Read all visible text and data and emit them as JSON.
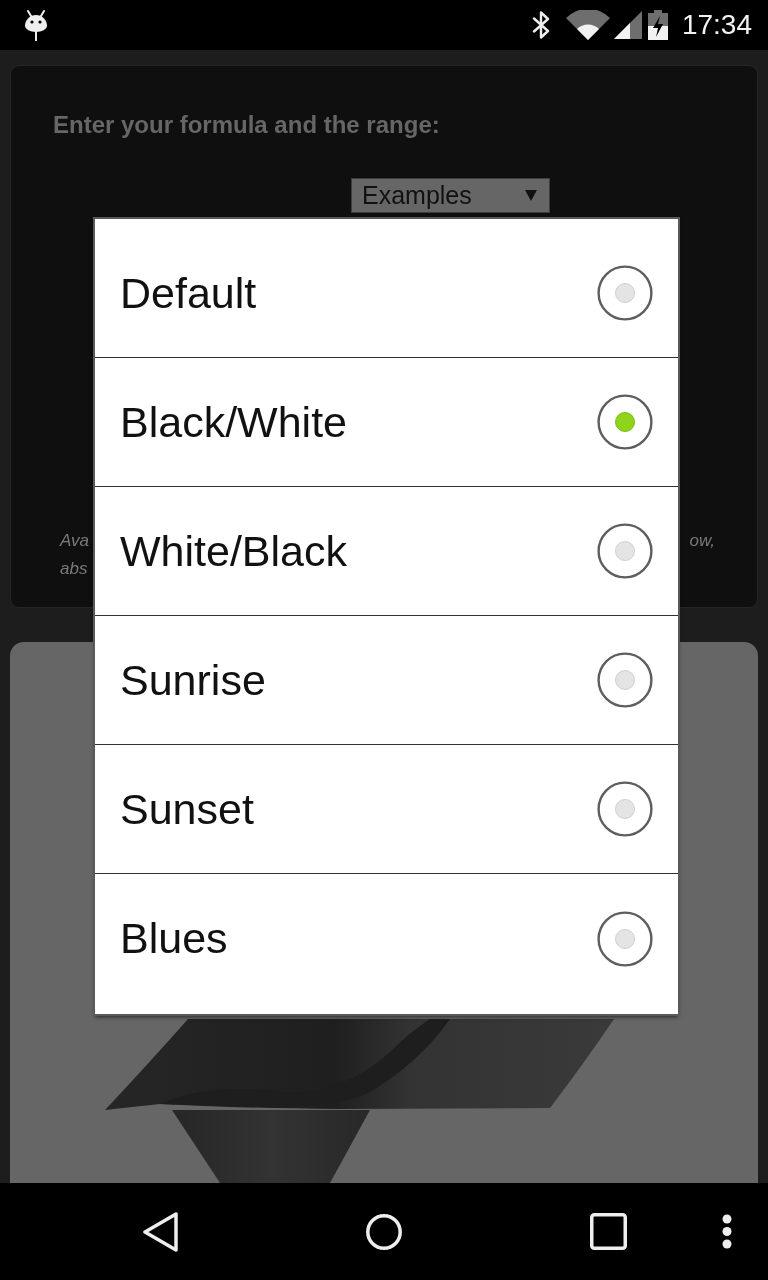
{
  "status_bar": {
    "time": "17:34"
  },
  "formula_panel": {
    "heading": "Enter your formula and the range:",
    "examples_dropdown": {
      "label": "Examples"
    },
    "note_left_lines": [
      "Ava",
      "abs"
    ],
    "note_right_lines": [
      "ow,"
    ]
  },
  "dialog": {
    "options": [
      {
        "label": "Default",
        "selected": false
      },
      {
        "label": "Black/White",
        "selected": true
      },
      {
        "label": "White/Black",
        "selected": false
      },
      {
        "label": "Sunrise",
        "selected": false
      },
      {
        "label": "Sunset",
        "selected": false
      },
      {
        "label": "Blues",
        "selected": false
      }
    ]
  }
}
